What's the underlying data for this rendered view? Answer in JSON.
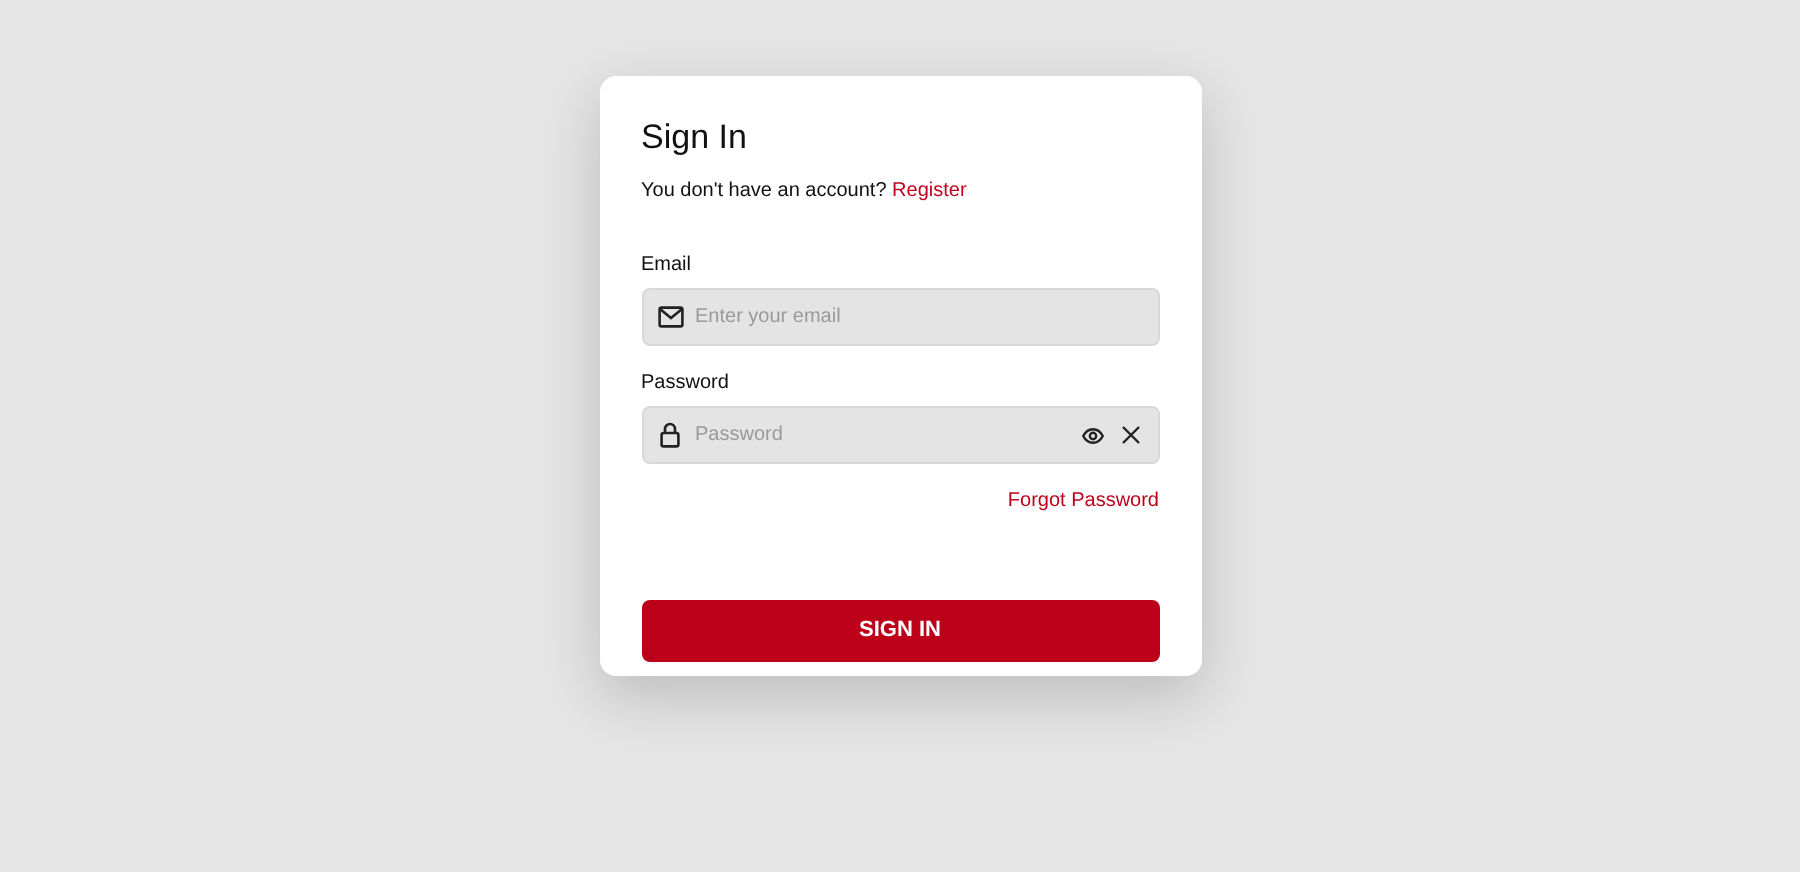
{
  "card": {
    "title": "Sign In",
    "prompt": {
      "text": "You don't have an account?",
      "link": "Register"
    },
    "fields": [
      {
        "kind": "email",
        "label": "Email",
        "placeholder": "Enter your email"
      },
      {
        "kind": "password",
        "label": "Password",
        "placeholder": "Password"
      }
    ],
    "forgot_link": "Forgot Password",
    "submit_button": "SIGN IN"
  }
}
